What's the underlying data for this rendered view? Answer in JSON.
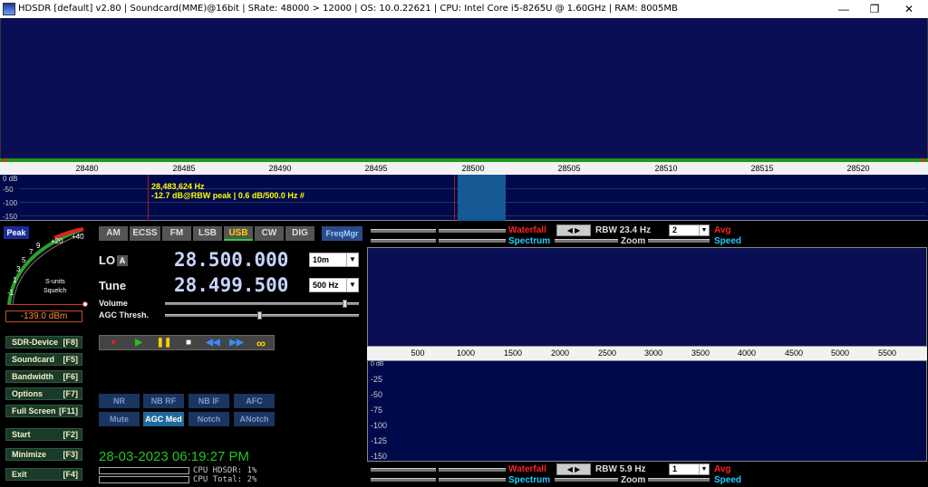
{
  "titlebar": {
    "title": "HDSDR  [default]  v2.80   | Soundcard(MME)@16bit  | SRate: 48000 > 12000  | OS: 10.0.22621  | CPU: Intel Core i5-8265U @ 1.60GHz  | RAM: 8005MB",
    "minimize": "—",
    "maximize": "❐",
    "close": "✕"
  },
  "freq_scale": [
    "28480",
    "28485",
    "28490",
    "28495",
    "28500",
    "28505",
    "28510",
    "28515",
    "28520"
  ],
  "spectrum_top": {
    "db_labels": [
      "0 dB",
      "-50",
      "-100",
      "-150"
    ],
    "peak_freq": "28,483,624 Hz",
    "peak_info": "-12.7 dB@RBW peak |   0.6 dB/500.0 Hz #"
  },
  "smeter": {
    "peak_label": "Peak",
    "scale": [
      "-1",
      "1",
      "3",
      "5",
      "7",
      "9",
      "+20",
      "+40"
    ],
    "units": "S-units",
    "squelch": "Squelch",
    "dbm": "-139.0 dBm"
  },
  "modes": [
    "AM",
    "ECSS",
    "FM",
    "LSB",
    "USB",
    "CW",
    "DIG"
  ],
  "active_mode": "USB",
  "freqmgr": "FreqMgr",
  "lo": {
    "label": "LO",
    "badge": "A",
    "value": "28.500.000",
    "band": "10m"
  },
  "tune": {
    "label": "Tune",
    "value": "28.499.500",
    "bw": "500 Hz"
  },
  "sliders": {
    "volume": "Volume",
    "agc": "AGC Thresh.",
    "volume_level": 0.94,
    "agc_level": 0.49
  },
  "left_buttons": [
    {
      "label": "SDR-Device",
      "key": "[F8]"
    },
    {
      "label": "Soundcard",
      "key": "[F5]"
    },
    {
      "label": "Bandwidth",
      "key": "[F6]"
    },
    {
      "label": "Options",
      "key": "[F7]"
    },
    {
      "label": "Full Screen",
      "key": "[F11]"
    },
    {
      "label": "Start",
      "key": "[F2]"
    },
    {
      "label": "Minimize",
      "key": "[F3]"
    },
    {
      "label": "Exit",
      "key": "[F4]"
    }
  ],
  "transport_icons": [
    "record-icon",
    "play-icon",
    "pause-icon",
    "stop-icon",
    "rewind-icon",
    "fast-forward-icon",
    "loop-icon"
  ],
  "dsp_row1": [
    "NR",
    "NB RF",
    "NB IF",
    "AFC"
  ],
  "dsp_row2": [
    "Mute",
    "AGC Med",
    "Notch",
    "ANotch"
  ],
  "active_dsp": "AGC Med",
  "clock": "28-03-2023 06:19:27 PM",
  "cpu": {
    "hdsdr": "CPU HDSDR:  1%",
    "total": "CPU Total:  2%"
  },
  "right_panel": {
    "waterfall": "Waterfall",
    "spectrum": "Spectrum",
    "rbw_top": "RBW 23.4 Hz",
    "rbw_bottom": "RBW  5.9 Hz",
    "zoom": "Zoom",
    "avg": "Avg",
    "speed": "Speed",
    "avg_top": "2",
    "avg_bottom": "1",
    "scale": [
      "500",
      "1000",
      "1500",
      "2000",
      "2500",
      "3000",
      "3500",
      "4000",
      "4500",
      "5000",
      "5500"
    ],
    "db_labels": [
      "0 dB",
      "-25",
      "-50",
      "-75",
      "-100",
      "-125",
      "-150"
    ]
  },
  "colors": {
    "waterfall": "#0a0f55",
    "spectrum": "#000a4a",
    "clock": "#22c422",
    "freq": "#c8d4ff",
    "active_mode": "#ffd200"
  }
}
